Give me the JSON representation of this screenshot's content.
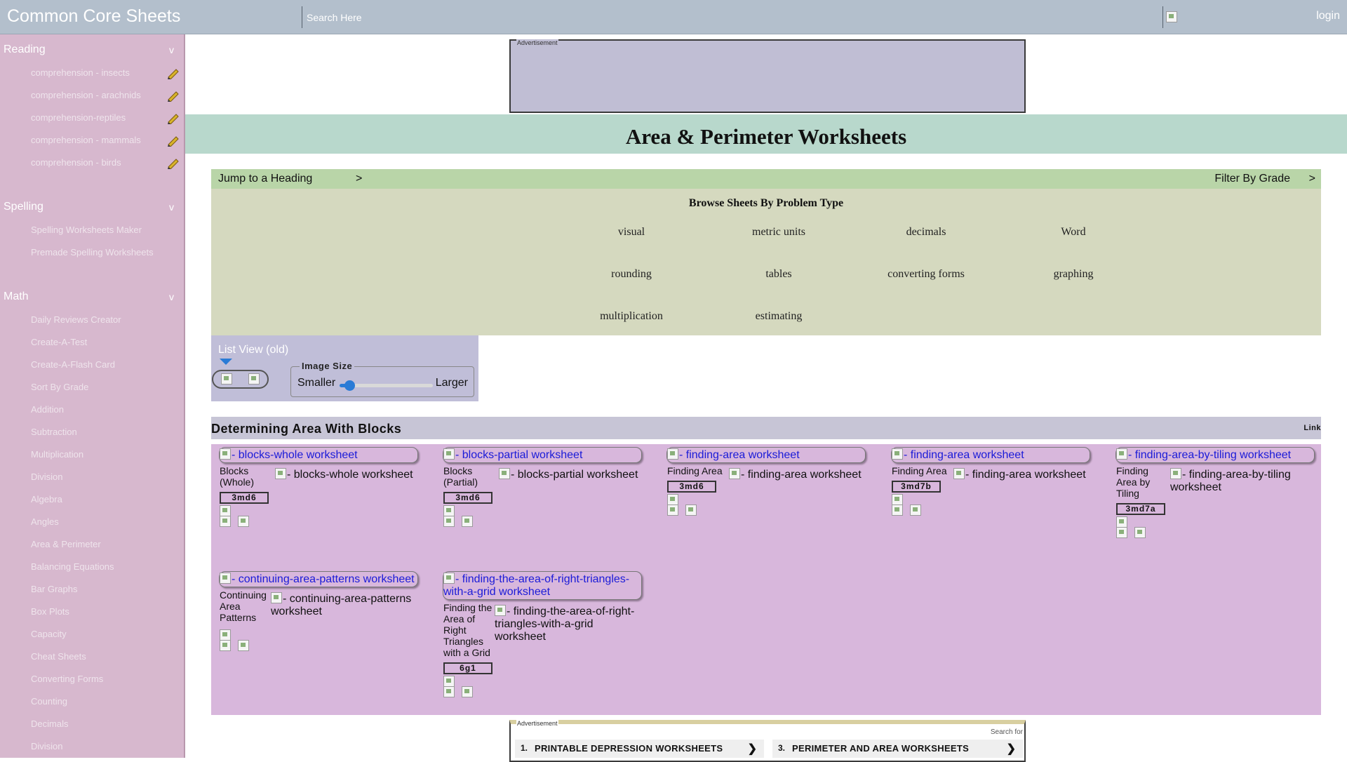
{
  "header": {
    "brand": "Common Core Sheets",
    "search_placeholder": "Search Here",
    "login": "login"
  },
  "sidebar": {
    "reading": {
      "title": "Reading",
      "chevron": "v",
      "items": [
        "comprehension - insects",
        "comprehension - arachnids",
        "comprehension-reptiles",
        "comprehension - mammals",
        "comprehension - birds"
      ]
    },
    "spelling": {
      "title": "Spelling",
      "chevron": "v",
      "items": [
        "Spelling Worksheets Maker",
        "Premade Spelling Worksheets"
      ]
    },
    "math": {
      "title": "Math",
      "chevron": "v",
      "items": [
        "Daily Reviews Creator",
        "Create-A-Test",
        "Create-A-Flash Card",
        "Sort By Grade",
        "Addition",
        "Subtraction",
        "Multiplication",
        "Division",
        "Algebra",
        "Angles",
        "Area & Perimeter",
        "Balancing Equations",
        "Bar Graphs",
        "Box Plots",
        "Capacity",
        "Cheat Sheets",
        "Converting Forms",
        "Counting",
        "Decimals",
        "Division"
      ]
    }
  },
  "ads": {
    "label": "Advertisement"
  },
  "page": {
    "title": "Area & Perimeter Worksheets"
  },
  "jump_bar": {
    "jump": "Jump to a Heading",
    "jump_arrow": ">",
    "filter": "Filter By Grade",
    "filter_arrow": ">"
  },
  "browse": {
    "title": "Browse Sheets By Problem Type",
    "types": [
      "visual",
      "metric units",
      "decimals",
      "Word",
      "rounding",
      "tables",
      "converting forms",
      "graphing",
      "multiplication",
      "estimating"
    ]
  },
  "view": {
    "list_view": "List View (old)",
    "image_size_legend": "Image Size",
    "smaller": "Smaller",
    "larger": "Larger",
    "slider_value": 0.05
  },
  "section": {
    "title": "Determining Area With Blocks",
    "link": "Link"
  },
  "cards": [
    {
      "link": "- blocks-whole worksheet",
      "name": "Blocks (Whole)",
      "alt": "- blocks-whole worksheet",
      "standard": "3md6"
    },
    {
      "link": "- blocks-partial worksheet",
      "name": "Blocks (Partial)",
      "alt": "- blocks-partial worksheet",
      "standard": "3md6"
    },
    {
      "link": "- finding-area worksheet",
      "name": "Finding Area",
      "alt": "- finding-area worksheet",
      "standard": "3md6"
    },
    {
      "link": "- finding-area worksheet",
      "name": "Finding Area",
      "alt": "- finding-area worksheet",
      "standard": "3md7b"
    },
    {
      "link": "- finding-area-by-tiling worksheet",
      "name": "Finding Area by Tiling",
      "alt": "- finding-area-by-tiling worksheet",
      "standard": "3md7a"
    },
    {
      "link": "- continuing-area-patterns worksheet",
      "name": "Continuing Area Patterns",
      "alt": "- continuing-area-patterns worksheet",
      "standard": ""
    },
    {
      "link": "- finding-the-area-of-right-triangles-with-a-grid worksheet",
      "name": "Finding the Area of Right Triangles with a Grid",
      "alt": "- finding-the-area-of-right-triangles-with-a-grid worksheet",
      "standard": "6g1"
    }
  ],
  "ad_bottom": {
    "search_for": "Search for",
    "links": [
      {
        "num": "1.",
        "text": "PRINTABLE DEPRESSION WORKSHEETS",
        "arrow": "❯"
      },
      {
        "num": "3.",
        "text": "PERIMETER AND AREA WORKSHEETS",
        "arrow": "❯"
      }
    ]
  },
  "colors": {
    "topbar": "#b3bfcc",
    "sidebar": "#d7b8ce",
    "title_band": "#b8d8cc",
    "jump_bar": "#b9d5a8",
    "browse_bg": "#d5d9bf",
    "cards_bg": "#d8b7dc",
    "link_blue": "#1b1bd8",
    "slider_blue": "#2a7bd6"
  }
}
